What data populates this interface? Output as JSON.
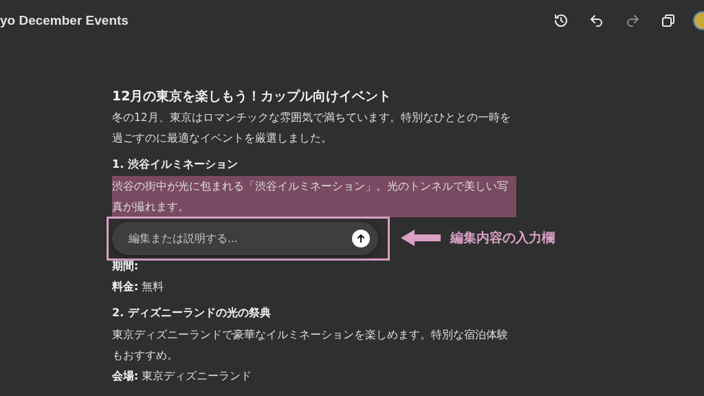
{
  "document_title": "yo December Events",
  "toolbar": [
    {
      "kind": "history",
      "disabled": false
    },
    {
      "kind": "undo",
      "disabled": false
    },
    {
      "kind": "redo",
      "disabled": true
    },
    {
      "kind": "copy",
      "disabled": false
    }
  ],
  "article": {
    "title": "12月の東京を楽しもう！カップル向けイベント",
    "intro": "冬の12月、東京はロマンチックな雰囲気で満ちています。特別なひととの一時を過ごすのに最適なイベントを厳選しました。",
    "sections": [
      {
        "heading": "1. 渋谷イルミネーション",
        "description": "渋谷の街中が光に包まれる「渋谷イルミネーション」。光のトンネルで美しい写真が撮れます。",
        "highlighted": true,
        "details": [
          {
            "label": "期間:"
          },
          {
            "label": "料金:",
            "value": "無料"
          }
        ]
      },
      {
        "heading": "2. ディズニーランドの光の祭典",
        "description": "東京ディズニーランドで豪華なイルミネーションを楽しめます。特別な宿泊体験もおすすめ。",
        "highlighted": false,
        "details": [
          {
            "label": "会場:",
            "value": "東京ディズニーランド"
          }
        ]
      }
    ]
  },
  "edit_popup": {
    "placeholder": "編集または説明する..."
  },
  "annotation": {
    "label": "編集内容の入力欄"
  }
}
